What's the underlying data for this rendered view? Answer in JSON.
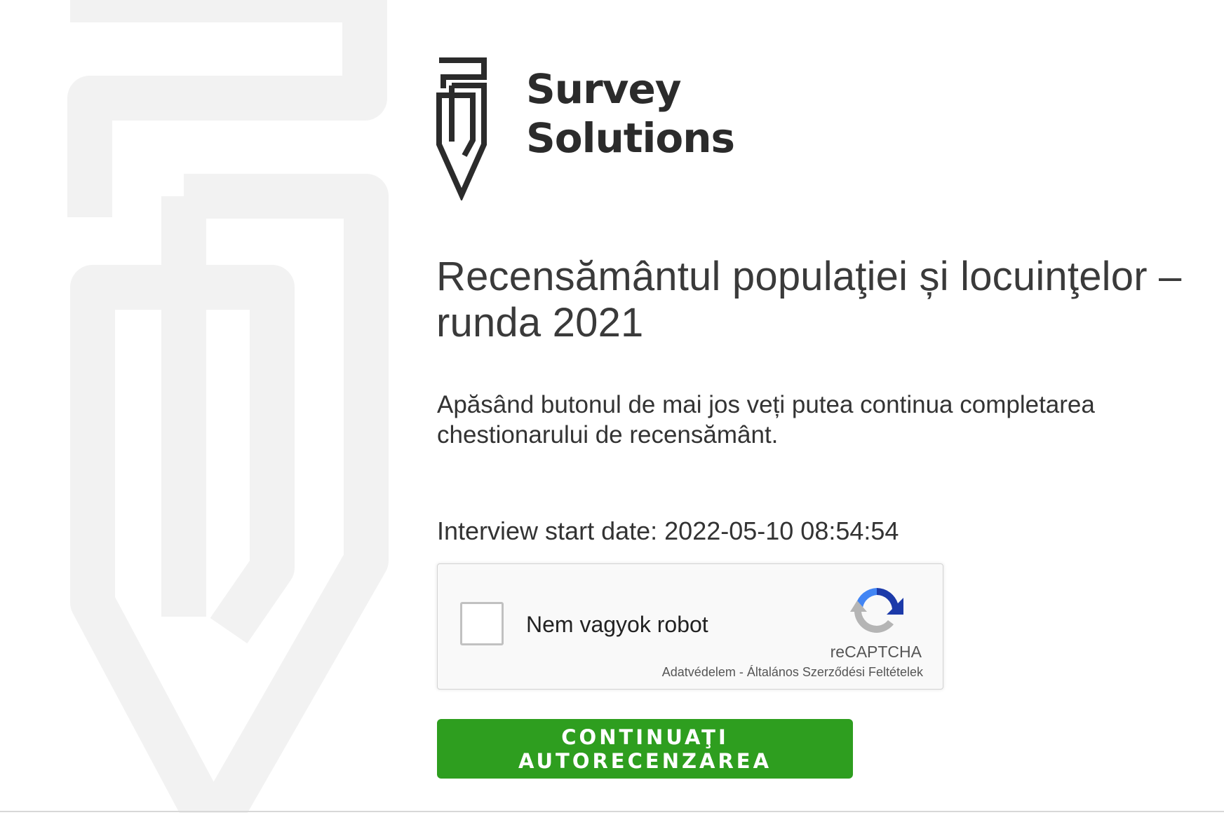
{
  "brand": {
    "name_line1": "Survey",
    "name_line2": "Solutions",
    "logo_icon": "pen-nib-logo-icon"
  },
  "main": {
    "title": "Recensământul populaţiei și locuinţelor – runda 2021",
    "description": "Apăsând butonul de mai jos veți putea continua completarea chestionarului de recensământ.",
    "start_date_label": "Interview start date:",
    "start_date_value": "2022-05-10 08:54:54"
  },
  "recaptcha": {
    "label": "Nem vagyok robot",
    "brand": "reCAPTCHA",
    "privacy_link": "Adatvédelem",
    "separator": " - ",
    "terms_link": "Általános Szerződési Feltételek",
    "icon": "recaptcha-logo-icon"
  },
  "actions": {
    "continue_label": "Continuaţi autorecenzarea"
  },
  "colors": {
    "accent_green": "#2e9e1f",
    "background_logo": "#f2f2f2",
    "text": "#333333"
  }
}
